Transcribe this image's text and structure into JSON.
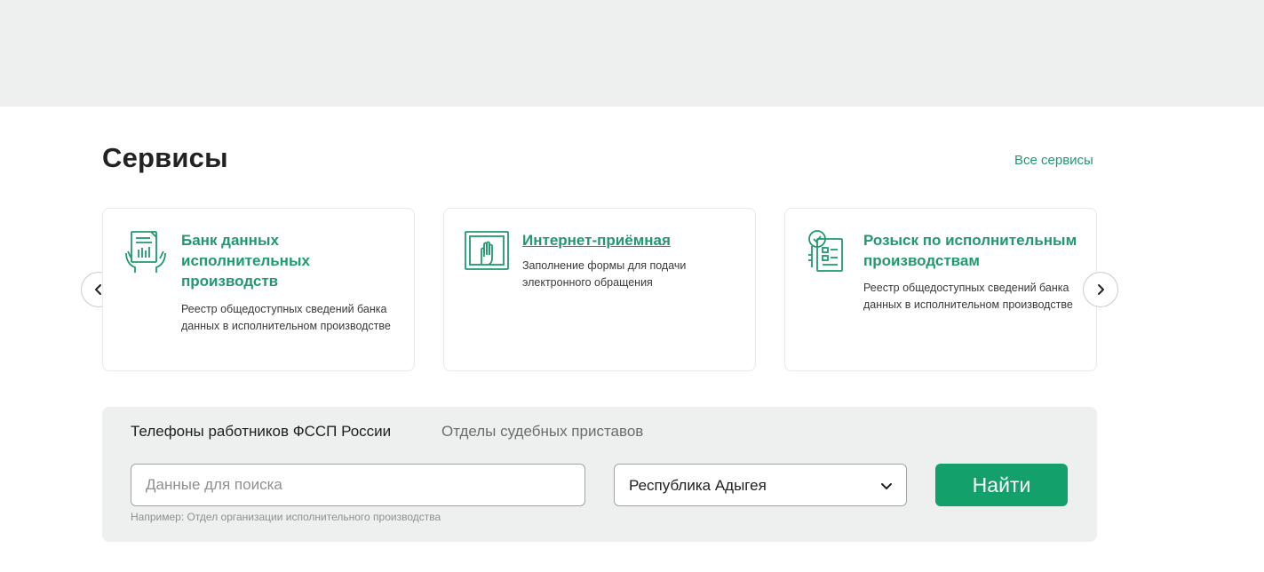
{
  "header": {
    "title": "Сервисы",
    "all_link": "Все сервисы"
  },
  "cards": [
    {
      "title": "Банк данных исполнительных производств",
      "description": "Реестр общедоступных сведений банка данных в исполнительном производстве",
      "icon": "document-hands-icon"
    },
    {
      "title": "Интернет-приёмная",
      "description": "Заполнение формы для подачи электронного обращения",
      "icon": "hand-screen-icon"
    },
    {
      "title": "Розыск по исполнительным производствам",
      "description": "Реестр общедоступных сведений банка данных в исполнительном производстве",
      "icon": "search-document-icon"
    }
  ],
  "nav": {
    "prev_icon": "chevron-left-icon",
    "next_icon": "chevron-right-icon"
  },
  "search": {
    "tabs": [
      {
        "label": "Телефоны работников ФССП России"
      },
      {
        "label": "Отделы судебных приставов"
      }
    ],
    "input_placeholder": "Данные для поиска",
    "hint": "Например: Отдел организации исполнительного производства",
    "region": "Республика Адыгея",
    "button": "Найти"
  },
  "colors": {
    "accent": "#1f9a6c",
    "button": "#14a06b",
    "band": "#eeefef"
  }
}
